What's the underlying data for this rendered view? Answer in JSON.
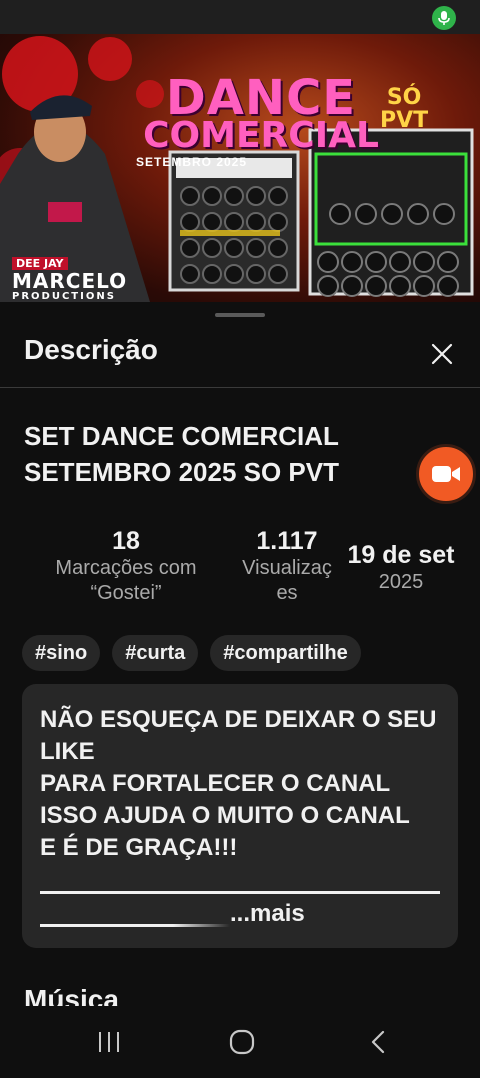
{
  "thumbnail": {
    "title_line1": "DANCE",
    "title_line2": "COMERCIAL",
    "date": "SETEMBRO 2025",
    "badge_line1": "SÓ",
    "badge_line2": "PVT",
    "brand_tag": "DEE JAY",
    "brand_name": "MARCELO",
    "brand_sub": "PRODUCTIONS"
  },
  "sheet": {
    "title": "Descrição",
    "video_title": "SET DANCE COMERCIAL SETEMBRO 2025 SO PVT"
  },
  "stats": {
    "likes_value": "18",
    "likes_label_1": "Marcações com",
    "likes_label_2": "“Gostei”",
    "views_value": "1.117",
    "views_label_1": "Visualizaç",
    "views_label_2": "es",
    "date_value": "19 de set",
    "date_year": "2025"
  },
  "tags": [
    "#sino",
    "#curta",
    "#compartilhe"
  ],
  "description": {
    "lines": [
      "NÃO ESQUEÇA DE DEIXAR O SEU",
      "LIKE",
      "PARA FORTALECER O CANAL",
      "ISSO AJUDA O MUITO O CANAL",
      "E É DE GRAÇA!!!"
    ],
    "more_label": "...mais"
  },
  "sections": {
    "music_heading": "Música"
  },
  "colors": {
    "background": "#0f0f0f",
    "card": "#272727",
    "accent_record": "#f15a24",
    "mic_active": "#2fb34a",
    "secondary_text": "#aaaaaa"
  },
  "icons": {
    "close": "close-icon",
    "record": "video-camera-icon",
    "mic": "microphone-icon",
    "recents": "recent-apps-icon",
    "home": "home-icon",
    "back": "back-icon"
  }
}
